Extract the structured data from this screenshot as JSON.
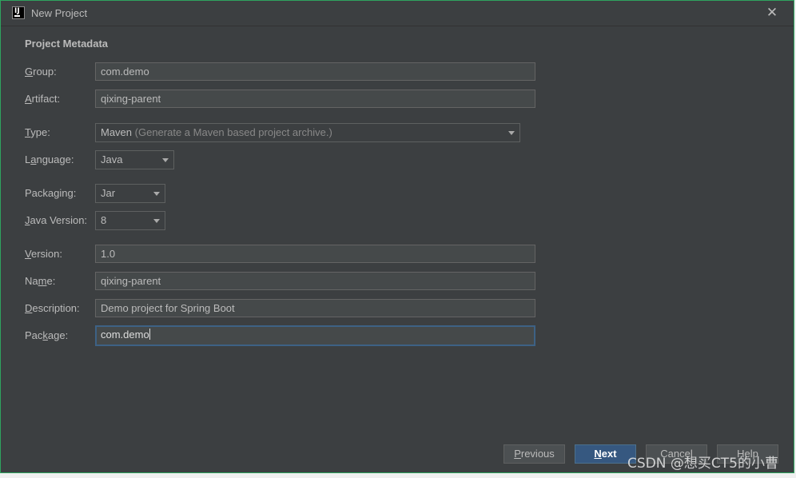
{
  "window": {
    "title": "New Project",
    "close_icon": "close-icon",
    "app_icon_text": "IJ"
  },
  "section": {
    "title": "Project Metadata"
  },
  "fields": {
    "group": {
      "label_mnemonic": "G",
      "label_rest": "roup:",
      "value": "com.demo"
    },
    "artifact": {
      "label_mnemonic": "A",
      "label_rest": "rtifact:",
      "value": "qixing-parent"
    },
    "type": {
      "label_mnemonic": "T",
      "label_rest": "ype:",
      "value": "Maven",
      "hint": "(Generate a Maven based project archive.)"
    },
    "language": {
      "label_pre": "L",
      "label_mnemonic": "a",
      "label_rest": "nguage:",
      "value": "Java"
    },
    "packaging": {
      "label_pre": "Packa",
      "label_mnemonic": "g",
      "label_rest": "ing:",
      "value": "Jar"
    },
    "java_version": {
      "label_mnemonic": "J",
      "label_rest": "ava Version:",
      "value": "8"
    },
    "version": {
      "label_mnemonic": "V",
      "label_rest": "ersion:",
      "value": "1.0"
    },
    "name": {
      "label_pre": "Na",
      "label_mnemonic": "m",
      "label_rest": "e:",
      "value": "qixing-parent"
    },
    "description": {
      "label_mnemonic": "D",
      "label_rest": "escription:",
      "value": "Demo project for Spring Boot"
    },
    "package": {
      "label_pre": "Pac",
      "label_mnemonic": "k",
      "label_rest": "age:",
      "value": "com.demo"
    }
  },
  "buttons": {
    "previous": {
      "mnemonic": "P",
      "rest": "revious"
    },
    "next": {
      "mnemonic": "N",
      "rest": "ext"
    },
    "cancel": "Cancel",
    "help": "Help"
  },
  "watermark": "CSDN @想买CT5的小曹",
  "colors": {
    "dialog_bg": "#3c3f41",
    "field_bg": "#45494a",
    "text": "#bbbbbb",
    "focus_border": "#3d6185",
    "primary_button": "#365880",
    "window_border": "#2fa35f"
  }
}
